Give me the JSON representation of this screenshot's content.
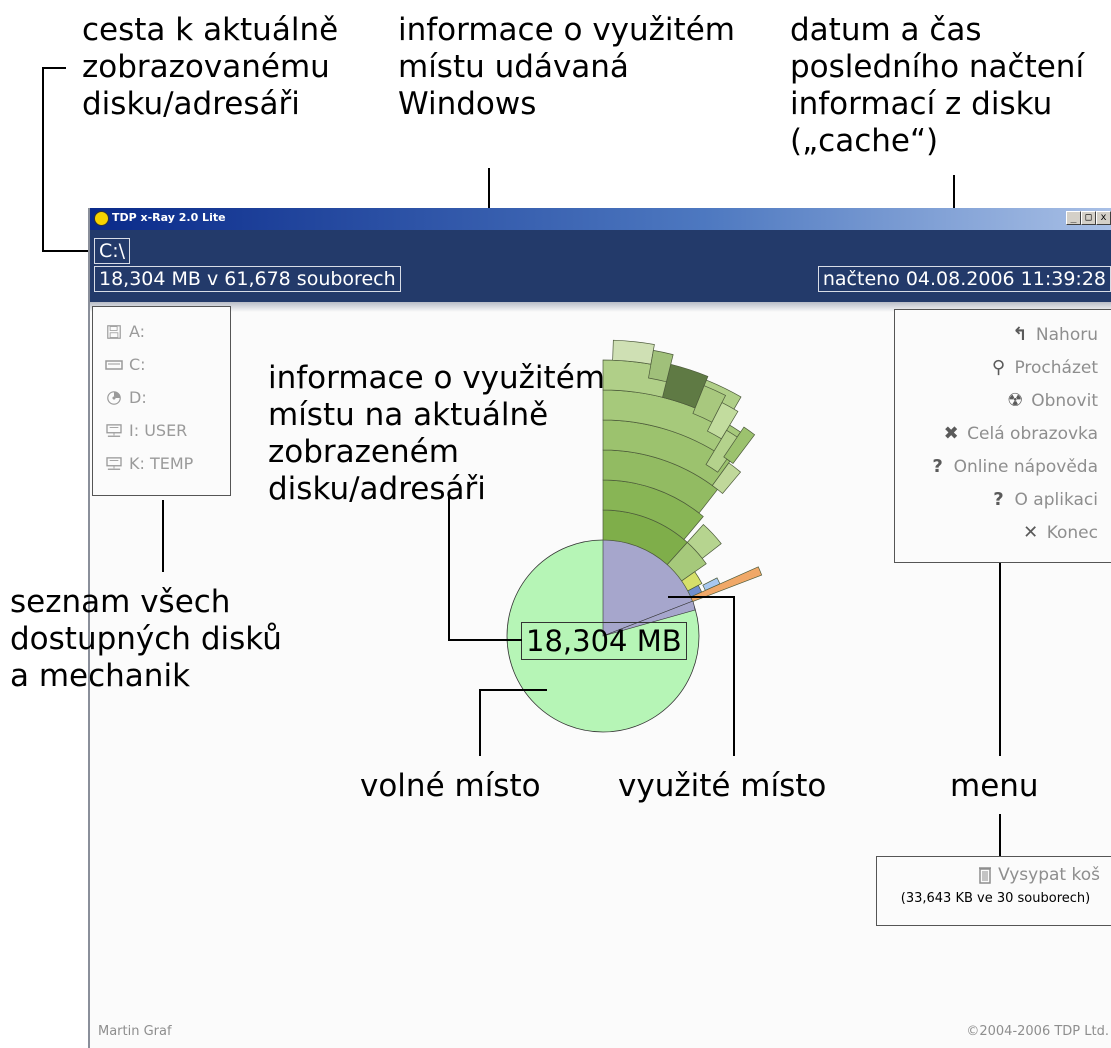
{
  "annotations": {
    "path_label": "cesta k aktuálně\nzobrazovanému\ndisku/adresáři",
    "windows_usage_label": "informace o využitém\nmístu udávaná\nWindows",
    "cache_label": "datum a čas\nposledního načtení\ninformací z disku\n(„cache“)",
    "current_usage_label": "informace o využitém\nmístu na aktuálně\nzobrazeném\ndisku/adresáři",
    "drives_label": "seznam všech\ndostupných disků\na mechanik",
    "free_space_label": "volné místo",
    "used_space_label": "využité místo",
    "menu_label": "menu"
  },
  "window": {
    "title": "TDP x-Ray 2.0 Lite",
    "controls": [
      "_",
      "□",
      "x"
    ],
    "path": "C:\\",
    "summary": "18,304 MB v 61,678 souborech",
    "loaded": "načteno 04.08.2006 11:39:28"
  },
  "drives": [
    {
      "label": "A:",
      "icon": "floppy-icon"
    },
    {
      "label": "C:",
      "icon": "harddisk-icon"
    },
    {
      "label": "D:",
      "icon": "cd-icon"
    },
    {
      "label": "I:  USER",
      "icon": "network-drive-icon"
    },
    {
      "label": "K: TEMP",
      "icon": "network-drive-icon"
    }
  ],
  "menu": [
    {
      "label": "Nahoru",
      "icon": "up-icon",
      "glyph": "↰"
    },
    {
      "label": "Procházet",
      "icon": "search-icon",
      "glyph": "⚲"
    },
    {
      "label": "Obnovit",
      "icon": "radiation-icon",
      "glyph": "☢"
    },
    {
      "label": "Celá obrazovka",
      "icon": "fullscreen-icon",
      "glyph": "✖"
    },
    {
      "label": "Online nápověda",
      "icon": "help-icon",
      "glyph": "?"
    },
    {
      "label": "O aplikaci",
      "icon": "about-icon",
      "glyph": "?"
    },
    {
      "label": "Konec",
      "icon": "exit-icon",
      "glyph": "✕"
    }
  ],
  "trash": {
    "label": "Vysypat koš",
    "info": "(33,643 KB ve 30 souborech)",
    "icon": "trash-icon"
  },
  "center_size": "18,304 MB",
  "footer": {
    "author": "Martin Graf",
    "copyright": "©2004-2006 TDP Ltd."
  },
  "colors": {
    "free_space": "#b6f5b6",
    "used_space": "#a6a6cc",
    "header": "#233a6a",
    "folder_green": "#8cbf5a"
  }
}
